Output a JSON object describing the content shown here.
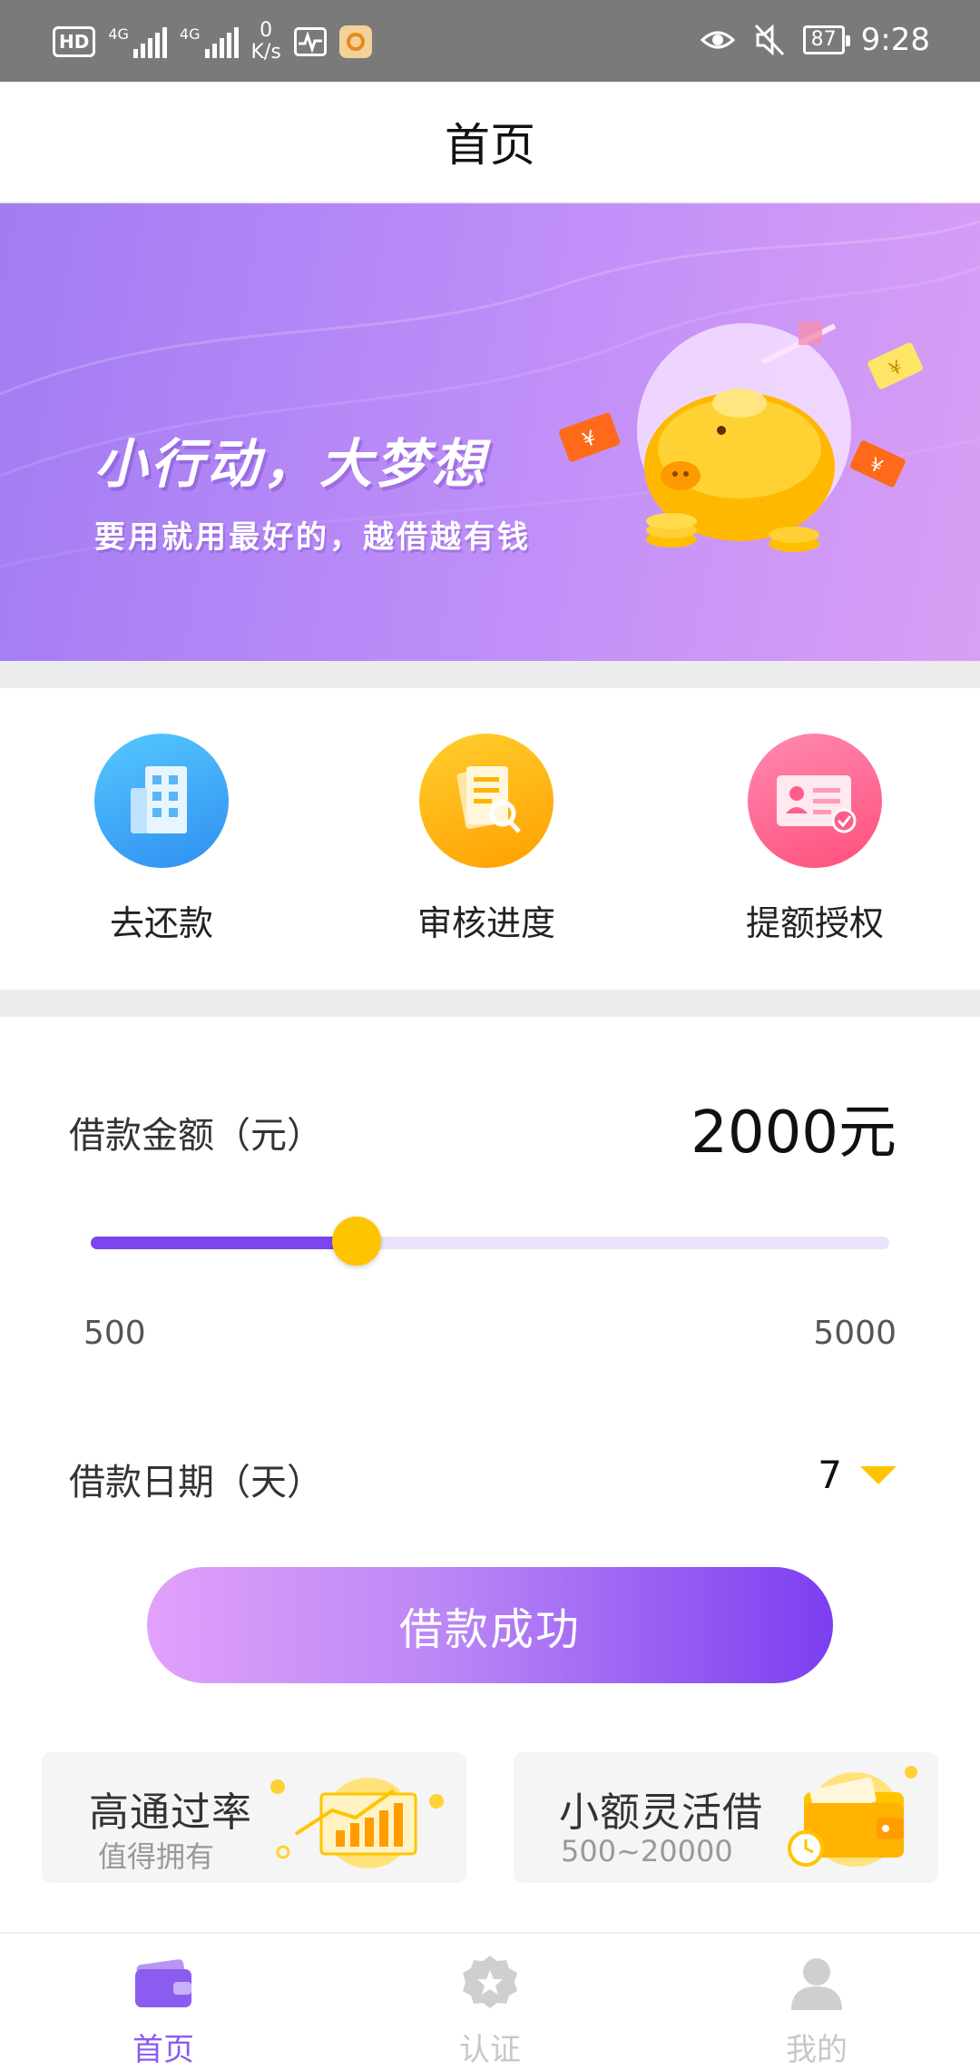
{
  "status_bar": {
    "hd": "HD",
    "net1": "4G",
    "net2": "4G",
    "speed_value": "0",
    "speed_unit": "K/s",
    "battery": "87",
    "time": "9:28"
  },
  "header": {
    "title": "首页"
  },
  "banner": {
    "title": "小行动，大梦想",
    "subtitle": "要用就用最好的，越借越有钱"
  },
  "quick_entries": [
    {
      "label": "去还款",
      "icon": "building-icon",
      "color": "#3aa0f5"
    },
    {
      "label": "审核进度",
      "icon": "document-search-icon",
      "color": "#ffa800"
    },
    {
      "label": "提额授权",
      "icon": "id-card-icon",
      "color": "#ff5e8a"
    }
  ],
  "loan": {
    "amount_label": "借款金额（元）",
    "amount_value": "2000元",
    "slider_min": "500",
    "slider_max": "5000",
    "slider_value": 2000,
    "days_label": "借款日期（天）",
    "days_value": "7",
    "submit_label": "借款成功"
  },
  "promo_cards": [
    {
      "title": "高通过率",
      "subtitle": "值得拥有",
      "icon": "chart-board-icon"
    },
    {
      "title": "小额灵活借",
      "subtitle": "500~20000",
      "icon": "wallet-icon"
    }
  ],
  "tabs": [
    {
      "label": "首页",
      "icon": "wallet-tab-icon",
      "active": true
    },
    {
      "label": "认证",
      "icon": "badge-star-icon",
      "active": false
    },
    {
      "label": "我的",
      "icon": "user-icon",
      "active": false
    }
  ],
  "colors": {
    "primary": "#7b46f0",
    "accent": "#ffc400",
    "tab_active": "#8a5cf0",
    "tab_inactive": "#c8c8c8"
  }
}
